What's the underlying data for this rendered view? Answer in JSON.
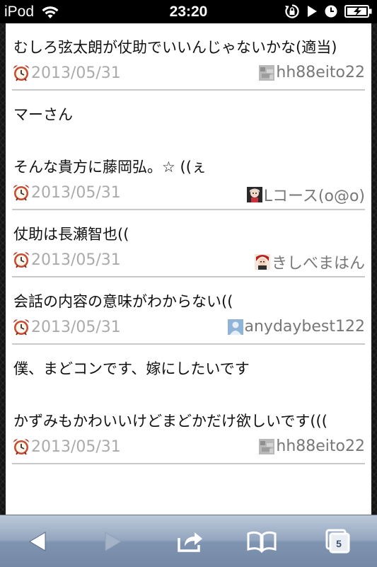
{
  "status_bar": {
    "carrier": "iPod",
    "time": "23:20",
    "icons": [
      "wifi-icon",
      "rotation-lock-icon",
      "play-icon",
      "alarm-icon",
      "battery-charging-icon"
    ]
  },
  "posts": [
    {
      "text": "むしろ弦太朗が仗助でいいんじゃないかな(適当)",
      "date": "2013/05/31",
      "user": "hh88eito22",
      "avatar": "gray-pixel-avatar"
    },
    {
      "text": "マーさん\n\nそんな貴方に藤岡弘。☆ ((ぇ",
      "date": "2013/05/31",
      "user": "Lコース(o@o)",
      "avatar": "anime-character-avatar"
    },
    {
      "text": "仗助は長瀬智也((",
      "date": "2013/05/31",
      "user": "きしべまはん",
      "avatar": "red-hair-character-avatar"
    },
    {
      "text": "会話の内容の意味がわからない((",
      "date": "2013/05/31",
      "user": "anydaybest122",
      "avatar": "default-person-avatar"
    },
    {
      "text": "僕、まどコンです、嫁にしたいです\n\nかずみもかわいいけどまどかだけ欲しいです(((",
      "date": "2013/05/31",
      "user": "hh88eito22",
      "avatar": "gray-pixel-avatar"
    }
  ],
  "toolbar": {
    "tabs_count": "5",
    "buttons": [
      "back-icon",
      "forward-icon",
      "share-icon",
      "bookmarks-icon",
      "tabs-icon"
    ]
  }
}
